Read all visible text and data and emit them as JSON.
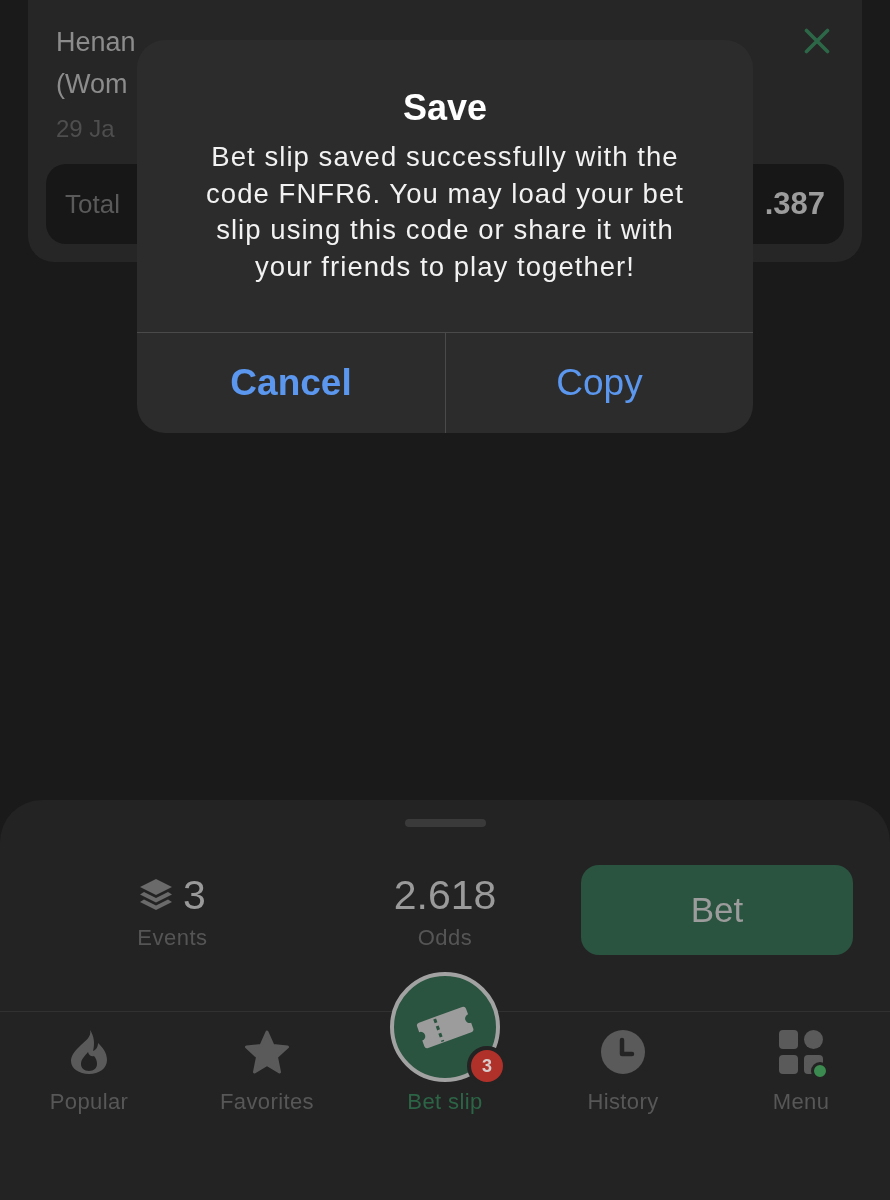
{
  "event_card": {
    "title_fragments": [
      "Henan",
      "(Wom"
    ],
    "date": "29 Ja",
    "total_label": "Total",
    "total_value": ".387"
  },
  "dialog": {
    "title": "Save",
    "message": "Bet slip saved successfully with the code FNFR6. You may load your bet slip using this code or share it with your friends to play together!",
    "buttons": [
      {
        "label": "Cancel",
        "kind": "cancel"
      },
      {
        "label": "Copy",
        "kind": "default"
      }
    ]
  },
  "bet_summary": {
    "events_count": "3",
    "events_label": "Events",
    "odds_value": "2.618",
    "odds_label": "Odds",
    "bet_button": "Bet"
  },
  "tab_bar": [
    {
      "label": "Popular",
      "kind": "plain",
      "selected": false,
      "notification": false
    },
    {
      "label": "Favorites",
      "kind": "plain",
      "selected": false,
      "notification": false
    },
    {
      "label": "Bet slip",
      "kind": "raised",
      "selected": true,
      "badge": "3",
      "notification": false
    },
    {
      "label": "History",
      "kind": "plain",
      "selected": false,
      "notification": false
    },
    {
      "label": "Menu",
      "kind": "plain",
      "selected": false,
      "notification": true
    }
  ]
}
